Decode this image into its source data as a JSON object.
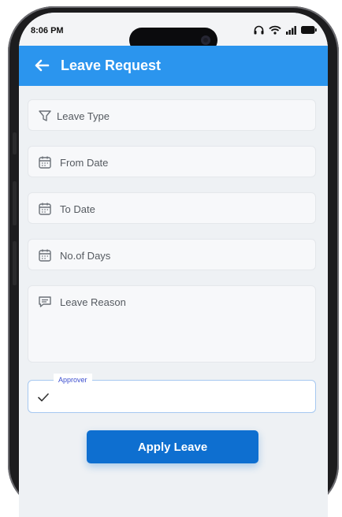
{
  "status_bar": {
    "time": "8:06 PM"
  },
  "header": {
    "title": "Leave Request"
  },
  "form": {
    "leave_type": "Leave Type",
    "from_date": "From Date",
    "to_date": "To Date",
    "num_days": "No.of Days",
    "leave_reason": "Leave Reason",
    "approver_label": "Approver"
  },
  "actions": {
    "apply_label": "Apply Leave"
  },
  "icons": {
    "back": "arrow-left-icon",
    "leave_type": "filter-icon",
    "dates": "calendar-icon",
    "reason": "message-icon",
    "approver": "check-icon"
  },
  "colors": {
    "appbar": "#2b95ee",
    "button": "#0e6fd0",
    "approver_label": "#3d4fcf"
  }
}
